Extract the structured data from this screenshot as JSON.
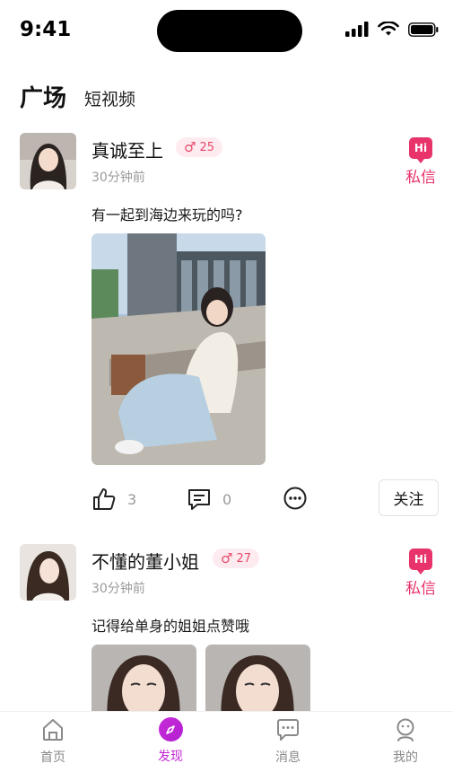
{
  "status_bar": {
    "time": "9:41"
  },
  "header": {
    "tab_active": "广场",
    "tab_other": "短视频"
  },
  "posts": [
    {
      "name": "真诚至上",
      "gender_symbol": "♂",
      "age": "25",
      "time_ago": "30分钟前",
      "hi_label": "Hi",
      "message_label": "私信",
      "text": "有一起到海边来玩的吗?",
      "likes": "3",
      "comments": "0",
      "follow_label": "关注"
    },
    {
      "name": "不懂的董小姐",
      "gender_symbol": "♂",
      "age": "27",
      "time_ago": "30分钟前",
      "hi_label": "Hi",
      "message_label": "私信",
      "text": "记得给单身的姐姐点赞哦"
    }
  ],
  "bottom_nav": {
    "items": [
      {
        "label": "首页",
        "icon": "home-icon"
      },
      {
        "label": "发现",
        "icon": "compass-icon"
      },
      {
        "label": "消息",
        "icon": "chat-icon"
      },
      {
        "label": "我的",
        "icon": "profile-icon"
      }
    ],
    "active_index": 1
  },
  "colors": {
    "accent": "#e8346a",
    "nav_active": "#c126d2",
    "muted": "#9a9a9a"
  }
}
